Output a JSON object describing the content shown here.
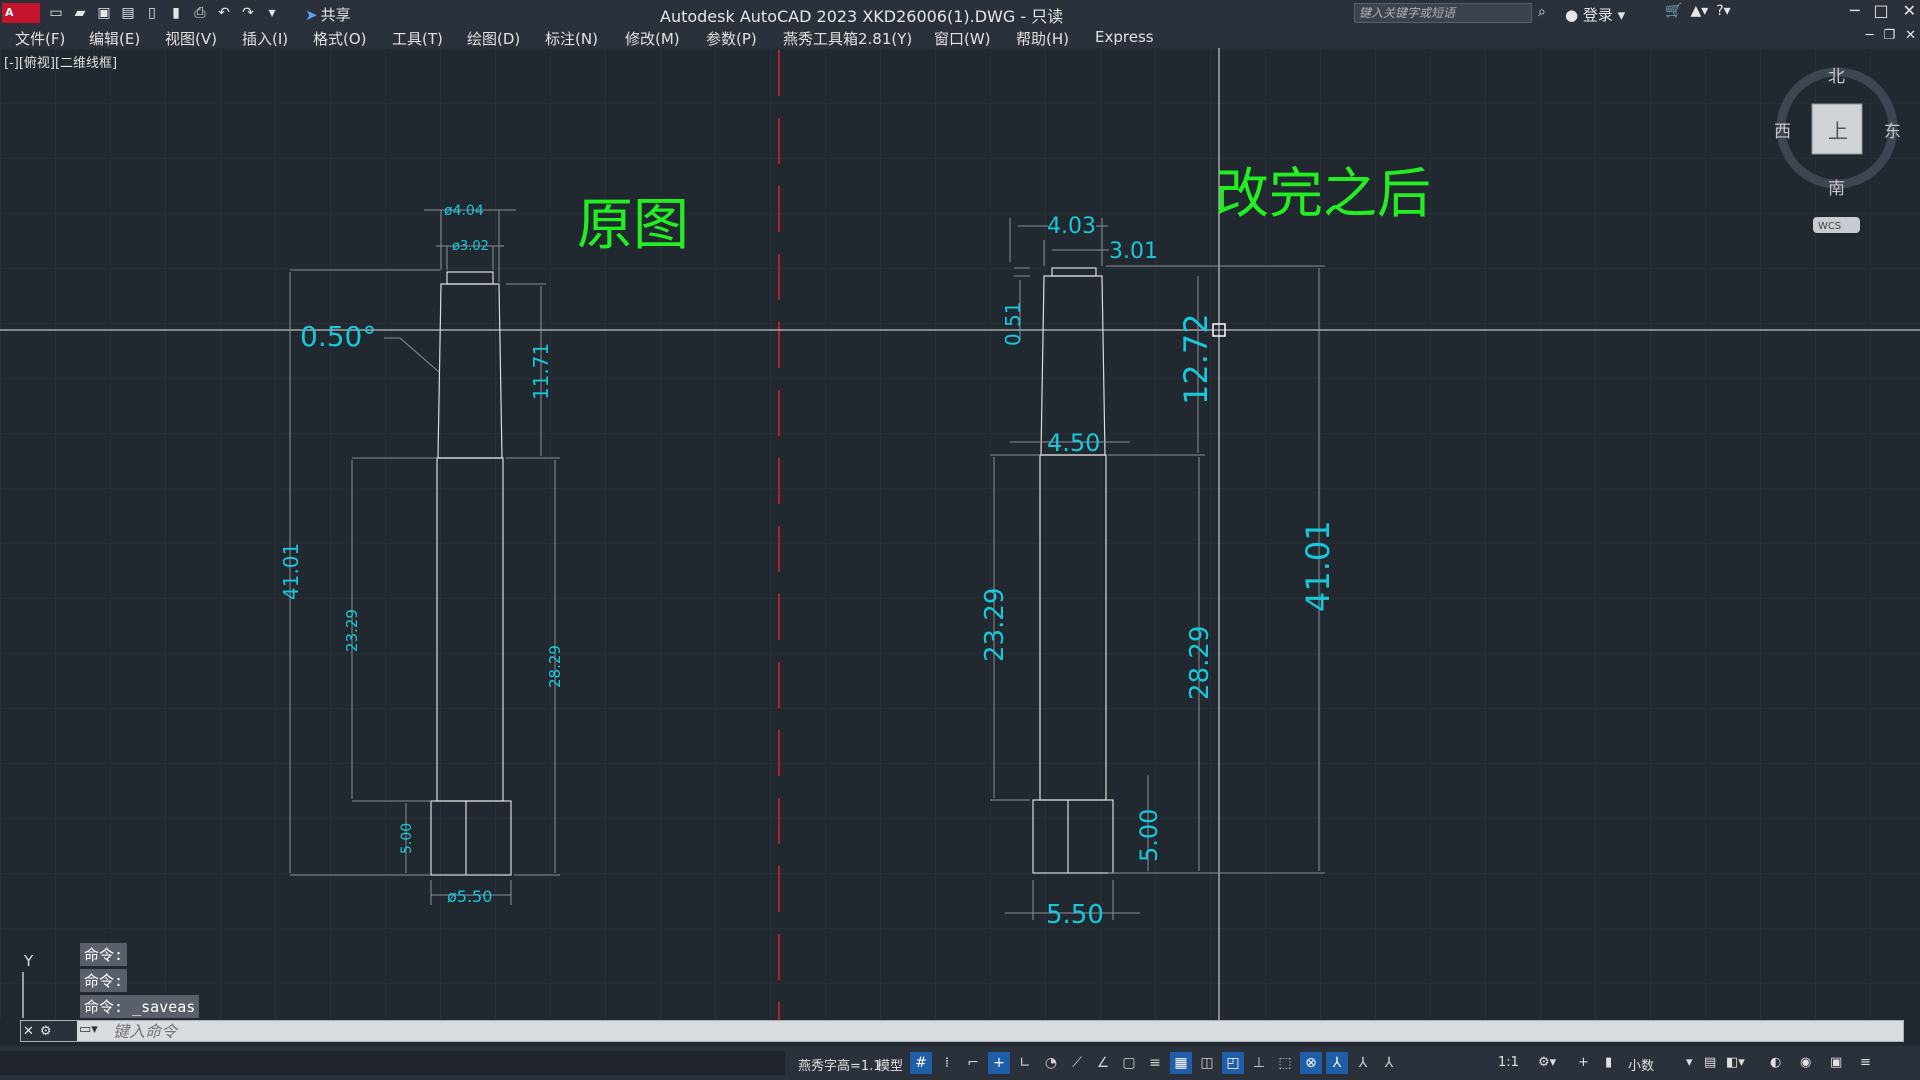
{
  "titlebar": {
    "logo": "A CAD",
    "share": "共享",
    "title": "Autodesk AutoCAD 2023    XKD26006(1).DWG - 只读",
    "search_placeholder": "键入关键字或短语",
    "login": "登录"
  },
  "menu": [
    "文件(F)",
    "编辑(E)",
    "视图(V)",
    "插入(I)",
    "格式(O)",
    "工具(T)",
    "绘图(D)",
    "标注(N)",
    "修改(M)",
    "参数(P)",
    "燕秀工具箱2.81(Y)",
    "窗口(W)",
    "帮助(H)",
    "Express"
  ],
  "viewport": {
    "label": "[-][俯视][二维线框]"
  },
  "viewcube": {
    "north": "北",
    "south": "南",
    "east": "东",
    "west": "西",
    "face": "上",
    "wcs": "WCS"
  },
  "colors": {
    "background": "#212830",
    "geometry": "#dcdcdc",
    "dimension": "#18c8d8",
    "annotation_text": "#22ee22",
    "centerline": "#e0202a"
  },
  "drawing": {
    "left_title": "原图",
    "right_title": "改完之后",
    "left_dims": {
      "top_dia": "ø4.04",
      "inner_dia": "ø3.02",
      "angle": "0.50°",
      "taper_len": "11.71",
      "overall": "41.01",
      "body_left": "23.29",
      "body_right": "28.29",
      "base": "5.00",
      "base_dia": "ø5.50"
    },
    "right_dims": {
      "top": "4.03",
      "inner": "3.01",
      "step": "0.51",
      "taper_len": "12.72",
      "neck": "4.50",
      "body_left": "23.29",
      "body_right": "28.29",
      "overall": "41.01",
      "base": "5.00",
      "base_w": "5.50"
    }
  },
  "ucs": {
    "y": "Y"
  },
  "command": {
    "history": [
      "命令:",
      "命令:",
      "命令: _saveas"
    ],
    "placeholder": "键入命令"
  },
  "status": {
    "yx": "燕秀字高=1.1",
    "model": "模型",
    "scale": "1:1",
    "units": "小数"
  }
}
